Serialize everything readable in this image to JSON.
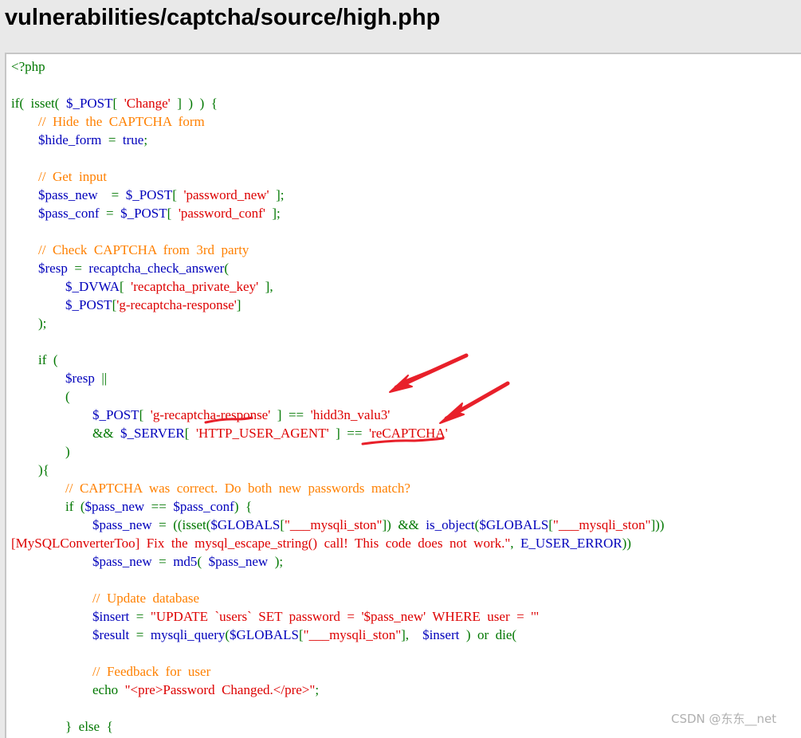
{
  "page": {
    "title": "vulnerabilities/captcha/source/high.php"
  },
  "colors": {
    "keyword": "#007700",
    "variable": "#0000bb",
    "string": "#dd0000",
    "comment": "#ff8000",
    "annotation": "#e8202a",
    "watermark": "#b0b0b0",
    "page_background": "#e9e9e9"
  },
  "code": {
    "lines": [
      [
        [
          "kw",
          "<?php"
        ]
      ],
      [],
      [
        [
          "kw",
          "if(  isset(  "
        ],
        [
          "var",
          "$_POST"
        ],
        [
          "kw",
          "[  "
        ],
        [
          "str",
          "'Change'"
        ],
        [
          "kw",
          "  ]  )  )  {"
        ]
      ],
      [
        [
          "kw",
          "        "
        ],
        [
          "com",
          "//  Hide  the  CAPTCHA  form"
        ]
      ],
      [
        [
          "kw",
          "        "
        ],
        [
          "var",
          "$hide_form"
        ],
        [
          "kw",
          "  =  "
        ],
        [
          "var",
          "true"
        ],
        [
          "kw",
          ";"
        ]
      ],
      [],
      [
        [
          "kw",
          "        "
        ],
        [
          "com",
          "//  Get  input"
        ]
      ],
      [
        [
          "kw",
          "        "
        ],
        [
          "var",
          "$pass_new"
        ],
        [
          "kw",
          "    =  "
        ],
        [
          "var",
          "$_POST"
        ],
        [
          "kw",
          "[  "
        ],
        [
          "str",
          "'password_new'"
        ],
        [
          "kw",
          "  ];"
        ]
      ],
      [
        [
          "kw",
          "        "
        ],
        [
          "var",
          "$pass_conf"
        ],
        [
          "kw",
          "  =  "
        ],
        [
          "var",
          "$_POST"
        ],
        [
          "kw",
          "[  "
        ],
        [
          "str",
          "'password_conf'"
        ],
        [
          "kw",
          "  ];"
        ]
      ],
      [],
      [
        [
          "kw",
          "        "
        ],
        [
          "com",
          "//  Check  CAPTCHA  from  3rd  party"
        ]
      ],
      [
        [
          "kw",
          "        "
        ],
        [
          "var",
          "$resp"
        ],
        [
          "kw",
          "  =  "
        ],
        [
          "var",
          "recaptcha_check_answer"
        ],
        [
          "kw",
          "("
        ]
      ],
      [
        [
          "kw",
          "                "
        ],
        [
          "var",
          "$_DVWA"
        ],
        [
          "kw",
          "[  "
        ],
        [
          "str",
          "'recaptcha_private_key'"
        ],
        [
          "kw",
          "  ],"
        ]
      ],
      [
        [
          "kw",
          "                "
        ],
        [
          "var",
          "$_POST"
        ],
        [
          "kw",
          "["
        ],
        [
          "str",
          "'g-recaptcha-response'"
        ],
        [
          "kw",
          "]"
        ]
      ],
      [
        [
          "kw",
          "        );"
        ]
      ],
      [],
      [
        [
          "kw",
          "        if  ("
        ]
      ],
      [
        [
          "kw",
          "                "
        ],
        [
          "var",
          "$resp"
        ],
        [
          "kw",
          "  ||"
        ]
      ],
      [
        [
          "kw",
          "                ("
        ]
      ],
      [
        [
          "kw",
          "                        "
        ],
        [
          "var",
          "$_POST"
        ],
        [
          "kw",
          "[  "
        ],
        [
          "str",
          "'g-recaptcha-response'"
        ],
        [
          "kw",
          "  ]  ==  "
        ],
        [
          "str",
          "'hidd3n_valu3'"
        ]
      ],
      [
        [
          "kw",
          "                        &&  "
        ],
        [
          "var",
          "$_SERVER"
        ],
        [
          "kw",
          "[  "
        ],
        [
          "str",
          "'HTTP_USER_AGENT'"
        ],
        [
          "kw",
          "  ]  ==  "
        ],
        [
          "str",
          "'reCAPTCHA'"
        ]
      ],
      [
        [
          "kw",
          "                )"
        ]
      ],
      [
        [
          "kw",
          "        ){"
        ]
      ],
      [
        [
          "kw",
          "                "
        ],
        [
          "com",
          "//  CAPTCHA  was  correct.  Do  both  new  passwords  match?"
        ]
      ],
      [
        [
          "kw",
          "                if  ("
        ],
        [
          "var",
          "$pass_new"
        ],
        [
          "kw",
          "  ==  "
        ],
        [
          "var",
          "$pass_conf"
        ],
        [
          "kw",
          ")  {"
        ]
      ],
      [
        [
          "kw",
          "                        "
        ],
        [
          "var",
          "$pass_new"
        ],
        [
          "kw",
          "  =  ((isset("
        ],
        [
          "var",
          "$GLOBALS"
        ],
        [
          "kw",
          "["
        ],
        [
          "str",
          "\"___mysqli_ston\""
        ],
        [
          "kw",
          "])  &&  "
        ],
        [
          "var",
          "is_object"
        ],
        [
          "kw",
          "("
        ],
        [
          "var",
          "$GLOBALS"
        ],
        [
          "kw",
          "["
        ],
        [
          "str",
          "\"___mysqli_ston\""
        ],
        [
          "kw",
          "]))"
        ]
      ],
      [
        [
          "str",
          "[MySQLConverterToo]  Fix  the  mysql_escape_string()  call!  This  code  does  not  work.\""
        ],
        [
          "kw",
          ",  "
        ],
        [
          "var",
          "E_USER_ERROR"
        ],
        [
          "kw",
          "))"
        ]
      ],
      [
        [
          "kw",
          "                        "
        ],
        [
          "var",
          "$pass_new"
        ],
        [
          "kw",
          "  =  "
        ],
        [
          "var",
          "md5"
        ],
        [
          "kw",
          "(  "
        ],
        [
          "var",
          "$pass_new"
        ],
        [
          "kw",
          "  );"
        ]
      ],
      [],
      [
        [
          "kw",
          "                        "
        ],
        [
          "com",
          "//  Update  database"
        ]
      ],
      [
        [
          "kw",
          "                        "
        ],
        [
          "var",
          "$insert"
        ],
        [
          "kw",
          "  =  "
        ],
        [
          "str",
          "\"UPDATE  `users`  SET  password  =  '$pass_new'  WHERE  user  =  '\""
        ]
      ],
      [
        [
          "kw",
          "                        "
        ],
        [
          "var",
          "$result"
        ],
        [
          "kw",
          "  =  "
        ],
        [
          "var",
          "mysqli_query"
        ],
        [
          "kw",
          "("
        ],
        [
          "var",
          "$GLOBALS"
        ],
        [
          "kw",
          "["
        ],
        [
          "str",
          "\"___mysqli_ston\""
        ],
        [
          "kw",
          "],    "
        ],
        [
          "var",
          "$insert"
        ],
        [
          "kw",
          "  )  or  die("
        ]
      ],
      [],
      [
        [
          "kw",
          "                        "
        ],
        [
          "com",
          "//  Feedback  for  user"
        ]
      ],
      [
        [
          "kw",
          "                        echo  "
        ],
        [
          "str",
          "\"<pre>Password  Changed.</pre>\""
        ],
        [
          "kw",
          ";"
        ]
      ],
      [],
      [
        [
          "kw",
          "                }  else  {"
        ]
      ]
    ]
  },
  "watermark": {
    "text": "CSDN @东东__net"
  }
}
